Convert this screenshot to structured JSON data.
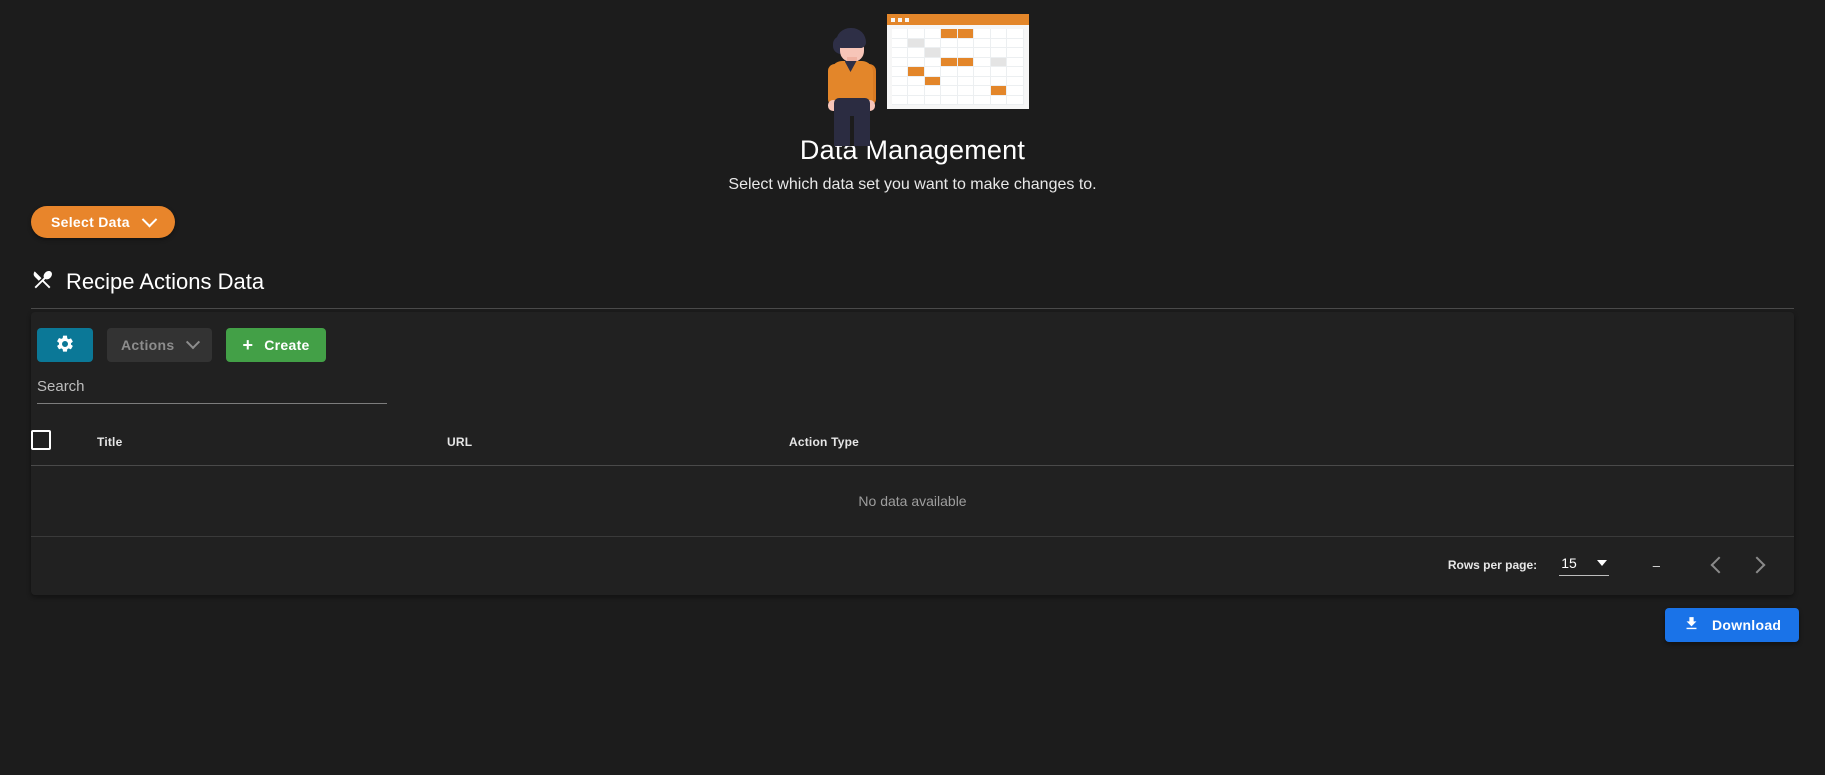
{
  "hero": {
    "illustration_name": "data-management-illustration",
    "title": "Data Management",
    "subtitle": "Select which data set you want to make changes to."
  },
  "select_data": {
    "label": "Select Data",
    "chevron_icon": "chevron-down-icon",
    "color": "#e8852b"
  },
  "section": {
    "icon": "restaurant-fork-knife-icon",
    "title": "Recipe Actions Data"
  },
  "toolbar": {
    "settings_icon": "gear-icon",
    "settings_color": "#0b7897",
    "actions_label": "Actions",
    "actions_chevron_icon": "chevron-down-icon",
    "actions_disabled": "true",
    "create_label": "Create",
    "create_plus_icon": "plus-icon",
    "create_color": "#43a047"
  },
  "search": {
    "placeholder": "Search",
    "value": ""
  },
  "table": {
    "select_all_checkbox": "checkbox-unchecked-icon",
    "columns": [
      "Title",
      "URL",
      "Action Type"
    ],
    "rows": [],
    "empty_message": "No data available"
  },
  "pagination": {
    "rows_per_page_label": "Rows per page:",
    "rows_per_page_value": "15",
    "caret_icon": "caret-down-icon",
    "range_text": "–",
    "prev_icon": "chevron-left-icon",
    "next_icon": "chevron-right-icon"
  },
  "download": {
    "label": "Download",
    "icon": "download-icon",
    "color": "#1a73e8"
  }
}
